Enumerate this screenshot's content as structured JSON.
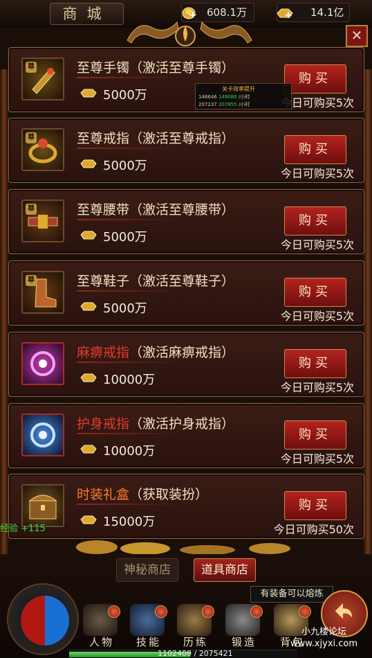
{
  "header": {
    "title": "商城",
    "gold_amount": "608.1万",
    "ingot_amount": "14.1亿"
  },
  "items": [
    {
      "name": "至尊手镯",
      "desc": "（激活至尊手镯）",
      "price": "5000万",
      "buy": "购买",
      "limit": "今日可购买5次",
      "name_color": "normal"
    },
    {
      "name": "至尊戒指",
      "desc": "（激活至尊戒指）",
      "price": "5000万",
      "buy": "购买",
      "limit": "今日可购买5次",
      "name_color": "normal"
    },
    {
      "name": "至尊腰带",
      "desc": "（激活至尊腰带）",
      "price": "5000万",
      "buy": "购买",
      "limit": "今日可购买5次",
      "name_color": "normal"
    },
    {
      "name": "至尊鞋子",
      "desc": "（激活至尊鞋子）",
      "price": "5000万",
      "buy": "购买",
      "limit": "今日可购买5次",
      "name_color": "normal"
    },
    {
      "name": "麻痹戒指",
      "desc": "（激活麻痹戒指）",
      "price": "10000万",
      "buy": "购买",
      "limit": "今日可购买5次",
      "name_color": "red"
    },
    {
      "name": "护身戒指",
      "desc": "（激活护身戒指）",
      "price": "10000万",
      "buy": "购买",
      "limit": "今日可购买5次",
      "name_color": "red"
    },
    {
      "name": "时装礼盒",
      "desc": "（获取装扮）",
      "price": "15000万",
      "buy": "购买",
      "limit": "今日可购买50次",
      "name_color": "orange"
    }
  ],
  "badge_text": "尊",
  "popup": {
    "title": "关卡效率提升",
    "row1_a": "148646",
    "row1_b": "149080",
    "row1_c": "/小时",
    "row2_a": "207237",
    "row2_b": "207855",
    "row2_c": "/小时"
  },
  "exp_text": "经验 +115",
  "tabs": {
    "mystery": "神秘商店",
    "items": "道具商店"
  },
  "hint": "有装备可以熔炼",
  "nav": [
    {
      "label": "人物"
    },
    {
      "label": "技能"
    },
    {
      "label": "历练"
    },
    {
      "label": "锻造"
    },
    {
      "label": "背包"
    }
  ],
  "xp": {
    "text": "1102409 / 2075421",
    "fraction": 0.531
  },
  "watermark": {
    "line1": "小九楼论坛",
    "line2": "www.xjyxi.com"
  },
  "colors": {
    "accent_red": "#b3231f",
    "gold": "#d28c4a",
    "exp_green": "#3ed34a"
  }
}
